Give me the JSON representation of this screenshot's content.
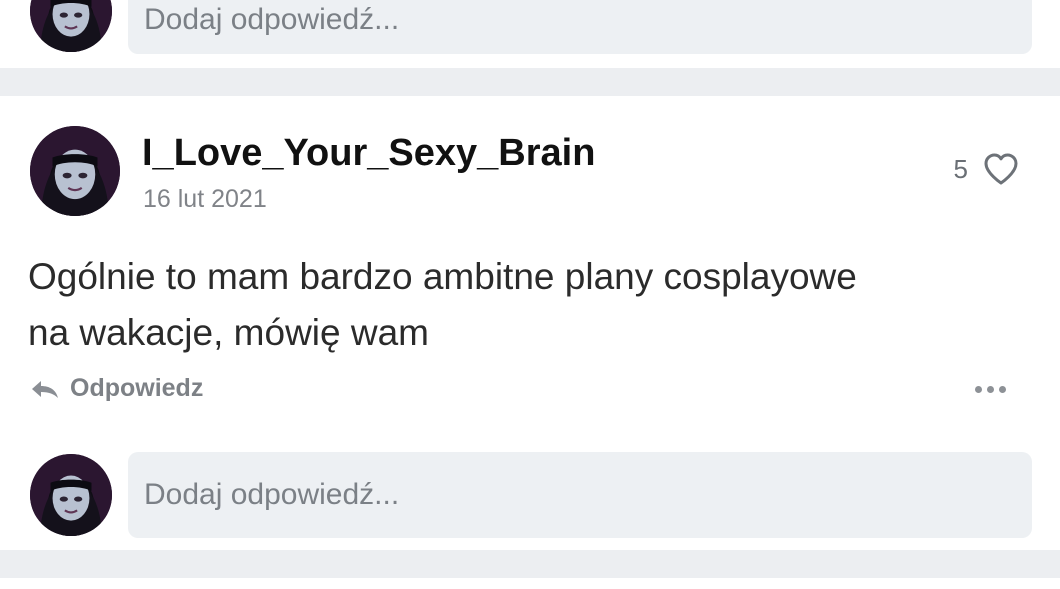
{
  "top_reply": {
    "placeholder": "Dodaj odpowiedź..."
  },
  "comment": {
    "username": "I_Love_Your_Sexy_Brain",
    "date": "16 lut 2021",
    "like_count": "5",
    "text_line1": "Ogólnie to mam bardzo ambitne plany cosplayowe",
    "text_line2": "na wakacje, mówię wam",
    "reply_label": "Odpowiedz"
  },
  "bottom_reply": {
    "placeholder": "Dodaj odpowiedź..."
  },
  "icons": {
    "avatar": "avatar",
    "heart": "heart-icon",
    "reply": "reply-icon",
    "more": "more-icon"
  },
  "colors": {
    "input_bg": "#edf0f3",
    "separator": "#eceef1",
    "meta_text": "#808388"
  }
}
